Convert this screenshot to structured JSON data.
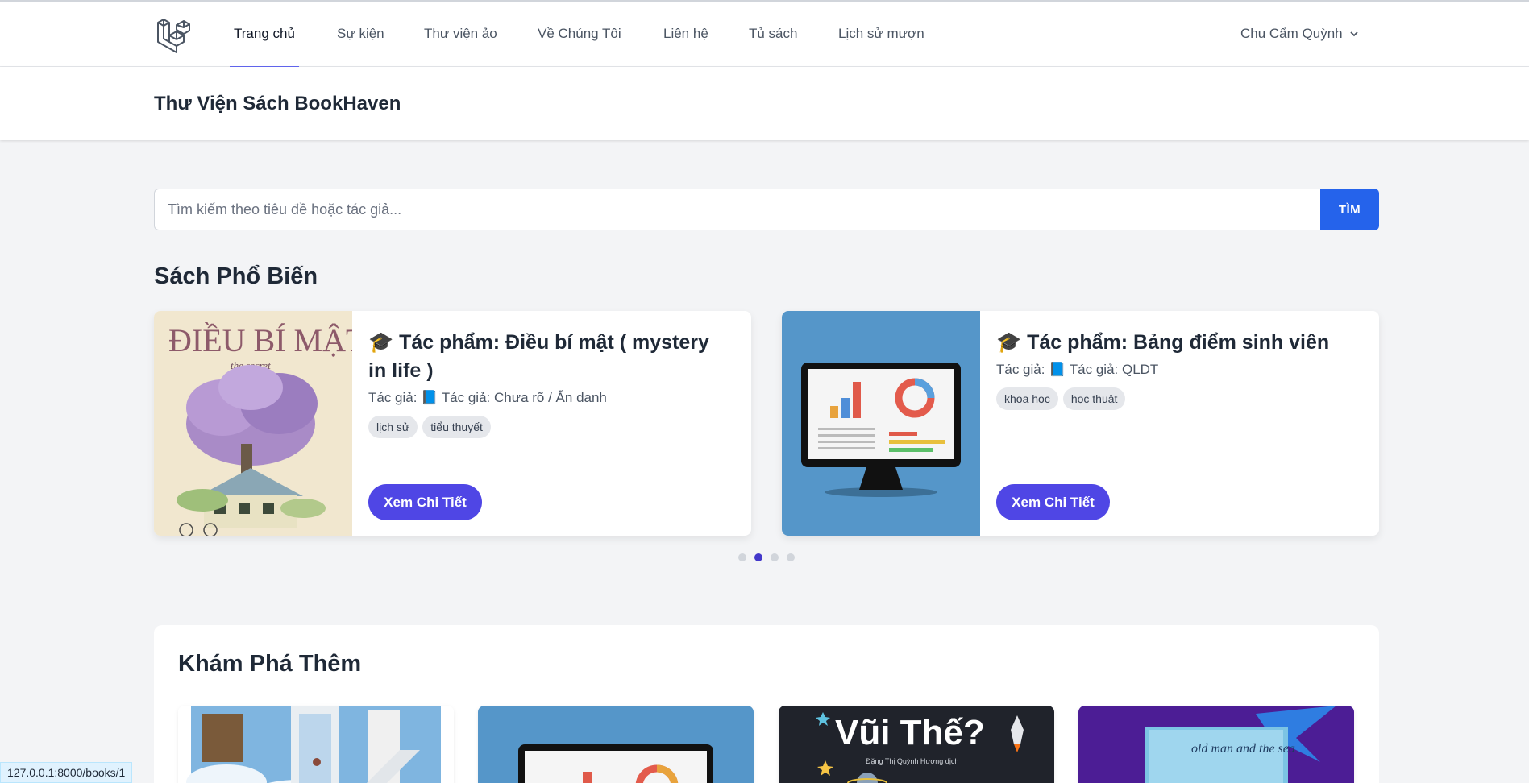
{
  "nav": {
    "items": [
      {
        "label": "Trang chủ",
        "active": true
      },
      {
        "label": "Sự kiện"
      },
      {
        "label": "Thư viện ảo"
      },
      {
        "label": "Về Chúng Tôi"
      },
      {
        "label": "Liên hệ"
      },
      {
        "label": "Tủ sách"
      },
      {
        "label": "Lịch sử mượn"
      }
    ],
    "user": "Chu Cẩm Quỳnh"
  },
  "header": {
    "title": "Thư Viện Sách BookHaven"
  },
  "search": {
    "placeholder": "Tìm kiếm theo tiêu đề hoặc tác giả...",
    "button": "TÌM"
  },
  "popular": {
    "heading": "Sách Phổ Biến",
    "books": [
      {
        "title": "🎓 Tác phẩm: Điều bí mật ( mystery in life )",
        "author": "Tác giả: 📘 Tác giả: Chưa rõ / Ẩn danh",
        "tags": [
          "lịch sử",
          "tiểu thuyết"
        ],
        "button": "Xem Chi Tiết",
        "cover_title": "ĐIỀU BÍ MẬT",
        "cover_subtitle": "the secret"
      },
      {
        "title": "🎓 Tác phẩm: Bảng điểm sinh viên",
        "author": "Tác giả: 📘 Tác giả: QLDT",
        "tags": [
          "khoa học",
          "học thuật"
        ],
        "button": "Xem Chi Tiết"
      }
    ],
    "carousel_pages": 4,
    "carousel_active": 1
  },
  "explore": {
    "heading": "Khám Phá Thêm",
    "cards": [
      {
        "cover": "doors-sky"
      },
      {
        "cover": "monitor-chart"
      },
      {
        "cover": "space",
        "cover_title": "Vũi Thế?",
        "cover_subtitle": "Đặng Thị Quỳnh Hương dịch"
      },
      {
        "cover": "old-man-sea",
        "cover_title": "old man and the sea"
      }
    ]
  },
  "status_url": "127.0.0.1:8000/books/1",
  "colors": {
    "primary": "#4f46e5",
    "search_button": "#2563eb",
    "page_bg": "#f3f4f6"
  }
}
